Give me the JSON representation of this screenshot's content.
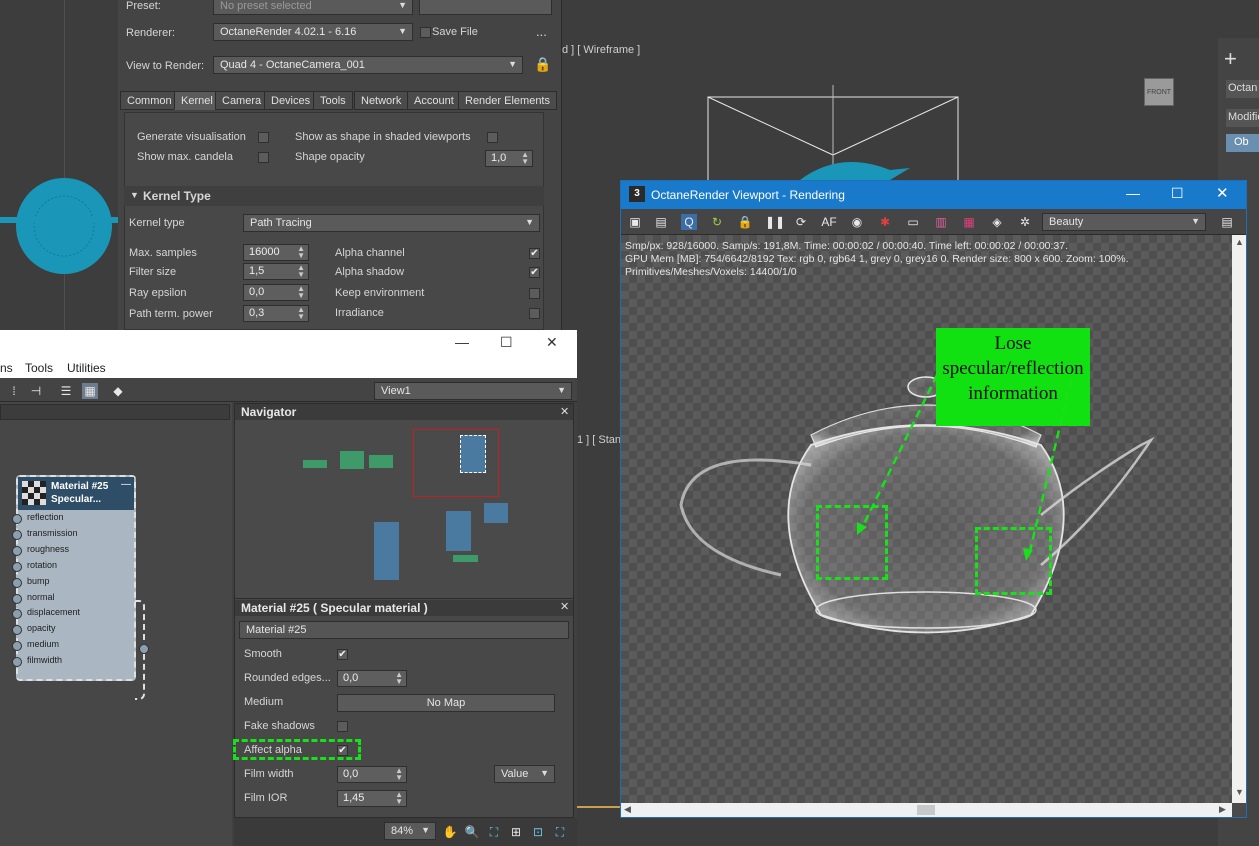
{
  "render_setup": {
    "preset_label": "Preset:",
    "preset_value": "No preset selected",
    "renderer_label": "Renderer:",
    "renderer_value": "OctaneRender 4.02.1 - 6.16",
    "save_file_label": "Save File",
    "view_label": "View to Render:",
    "view_value": "Quad 4 - OctaneCamera_001",
    "tabs": [
      "Common",
      "Kernel",
      "Camera",
      "Devices",
      "Tools",
      "Network",
      "Account",
      "Render Elements"
    ],
    "active_tab": "Kernel",
    "distribution": {
      "generate_vis": "Generate visualisation",
      "show_shape": "Show as shape in shaded viewports",
      "show_candela": "Show max. candela",
      "shape_opacity": "Shape opacity",
      "shape_opacity_value": "1,0"
    },
    "kernel_section": "Kernel Type",
    "kernel_type_label": "Kernel type",
    "kernel_type_value": "Path Tracing",
    "rows": [
      {
        "label": "Max. samples",
        "value": "16000",
        "opt": "Alpha channel",
        "checked": "✔"
      },
      {
        "label": "Filter size",
        "value": "1,5",
        "opt": "Alpha shadow",
        "checked": "✔"
      },
      {
        "label": "Ray epsilon",
        "value": "0,0",
        "opt": "Keep environment",
        "checked": ""
      },
      {
        "label": "Path term. power",
        "value": "0,3",
        "opt": "Irradiance",
        "checked": ""
      }
    ]
  },
  "viewport_labels": {
    "wireframe": "d ] [ Wireframe ]",
    "standard": "1 ] [ Stand",
    "front": "FRONT"
  },
  "right_panel": {
    "tab1": "Octan",
    "tab2": "Modifie",
    "tab3": "Ob"
  },
  "slate": {
    "menu": [
      "ns",
      "Tools",
      "Utilities"
    ],
    "view_value": "View1",
    "navigator_title": "Navigator",
    "node": {
      "title_line1": "Material #25",
      "title_line2": "Specular...",
      "ports": [
        "reflection",
        "transmission",
        "roughness",
        "rotation",
        "bump",
        "normal",
        "displacement",
        "opacity",
        "medium",
        "filmwidth"
      ]
    },
    "material_panel_title": "Material #25  ( Specular material )",
    "material_name": "Material #25",
    "props": {
      "smooth_label": "Smooth",
      "smooth_check": "✔",
      "rounded_label": "Rounded edges...",
      "rounded_value": "0,0",
      "medium_label": "Medium",
      "medium_value": "No Map",
      "fake_shadows_label": "Fake shadows",
      "affect_alpha_label": "Affect alpha",
      "affect_alpha_check": "✔",
      "film_width_label": "Film width",
      "film_width_value": "0,0",
      "film_width_mode": "Value",
      "film_ior_label": "Film IOR",
      "film_ior_value": "1,45"
    },
    "zoom": "84%"
  },
  "octane": {
    "title": "OctaneRender Viewport - Rendering",
    "pass_value": "Beauty",
    "stats": {
      "line1": "Smp/px: 928/16000.   Samp/s: 191,8M.   Time: 00:00:02 / 00:00:40.   Time left: 00:00:02 / 00:00:37.",
      "line2": "GPU Mem [MB]: 754/6642/8192   Tex: rgb 0, rgb64 1, grey 0, grey16 0.   Render size: 800 x 600.   Zoom: 100%.",
      "line3": "Primitives/Meshes/Voxels: 14400/1/0"
    },
    "annotation": "Lose specular/reflection information"
  }
}
